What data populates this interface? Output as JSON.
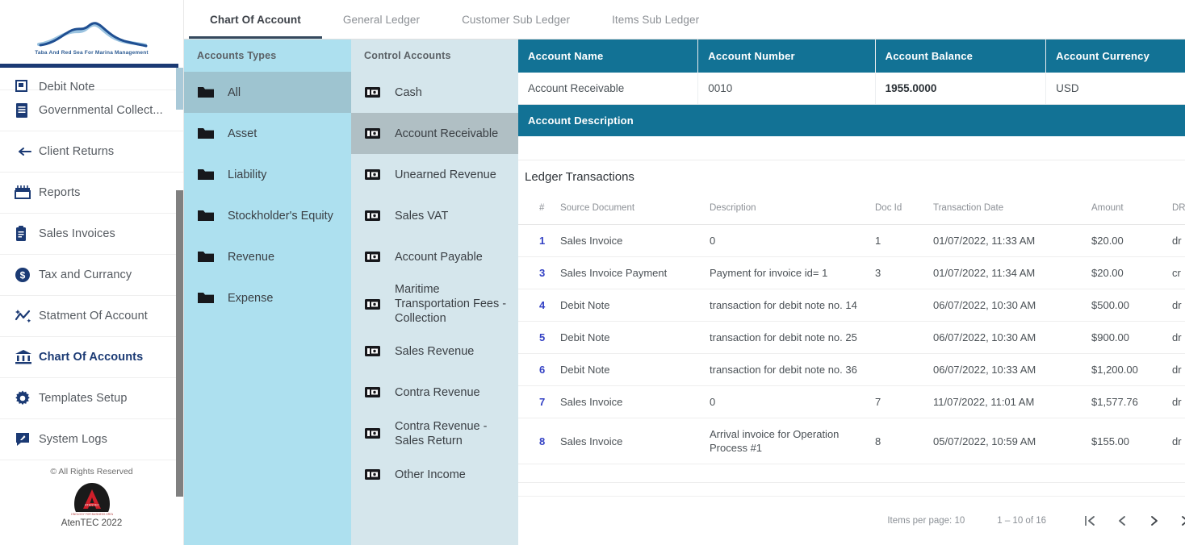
{
  "brand": {
    "subtitle": "Taba And  Red Sea For Marina Management",
    "logo_icon": "mountain-wave-logo"
  },
  "sidebar": {
    "items": [
      {
        "label": "Debit Note",
        "icon": "debit-note-icon",
        "active": false
      },
      {
        "label": "Governmental Collect...",
        "icon": "governmental-collection-icon",
        "active": false
      },
      {
        "label": "Client Returns",
        "icon": "return-arrow-icon",
        "active": false
      },
      {
        "label": "Reports",
        "icon": "reports-icon",
        "active": false
      },
      {
        "label": "Sales Invoices",
        "icon": "clipboard-icon",
        "active": false
      },
      {
        "label": "Tax and Currancy",
        "icon": "dollar-circle-icon",
        "active": false
      },
      {
        "label": "Statment Of Account",
        "icon": "trend-line-icon",
        "active": false
      },
      {
        "label": "Chart Of Accounts",
        "icon": "bank-icon",
        "active": true
      },
      {
        "label": "Templates Setup",
        "icon": "gear-icon",
        "active": false
      },
      {
        "label": "System Logs",
        "icon": "log-note-icon",
        "active": false
      }
    ],
    "footer": {
      "rights": "© All Rights Reserved",
      "vendor": "AtenTEC 2022",
      "vendor_logo_icon": "atentec-logo"
    }
  },
  "tabs": [
    {
      "label": "Chart Of Account",
      "active": true
    },
    {
      "label": "General Ledger",
      "active": false
    },
    {
      "label": "Customer Sub Ledger",
      "active": false
    },
    {
      "label": "Items Sub Ledger",
      "active": false
    }
  ],
  "accounts_types": {
    "header": "Accounts Types",
    "items": [
      {
        "label": "All",
        "icon": "folder-icon",
        "selected": true
      },
      {
        "label": "Asset",
        "icon": "folder-icon",
        "selected": false
      },
      {
        "label": "Liability",
        "icon": "folder-icon",
        "selected": false
      },
      {
        "label": "Stockholder's Equity",
        "icon": "folder-icon",
        "selected": false
      },
      {
        "label": "Revenue",
        "icon": "folder-icon",
        "selected": false
      },
      {
        "label": "Expense",
        "icon": "folder-icon",
        "selected": false
      }
    ]
  },
  "control_accounts": {
    "header": "Control Accounts",
    "items": [
      {
        "label": "Cash",
        "icon": "account-card-icon",
        "selected": false
      },
      {
        "label": "Account Receivable",
        "icon": "account-card-icon",
        "selected": true
      },
      {
        "label": "Unearned Revenue",
        "icon": "account-card-icon",
        "selected": false
      },
      {
        "label": "Sales VAT",
        "icon": "account-card-icon",
        "selected": false
      },
      {
        "label": "Account Payable",
        "icon": "account-card-icon",
        "selected": false
      },
      {
        "label": "Maritime Transportation Fees - Collection",
        "icon": "account-card-icon",
        "selected": false
      },
      {
        "label": "Sales Revenue",
        "icon": "account-card-icon",
        "selected": false
      },
      {
        "label": "Contra Revenue",
        "icon": "account-card-icon",
        "selected": false
      },
      {
        "label": "Contra Revenue - Sales Return",
        "icon": "account-card-icon",
        "selected": false
      },
      {
        "label": "Other Income",
        "icon": "account-card-icon",
        "selected": false
      }
    ]
  },
  "account_summary": {
    "columns": [
      "Account Name",
      "Account Number",
      "Account Balance",
      "Account Currency"
    ],
    "row": {
      "name": "Account Receivable",
      "number": "0010",
      "balance": "1955.0000",
      "currency": "USD"
    },
    "description_header": "Account Description",
    "description_value": ""
  },
  "ledger": {
    "title": "Ledger Transactions",
    "columns": [
      "#",
      "Source Document",
      "Description",
      "Doc Id",
      "Transaction Date",
      "Amount",
      "DR/CR"
    ],
    "rows": [
      {
        "idx": "1",
        "source": "Sales Invoice",
        "description": "0",
        "doc_id": "1",
        "date": "01/07/2022, 11:33 AM",
        "amount": "$20.00",
        "drcr": "dr"
      },
      {
        "idx": "3",
        "source": "Sales Invoice Payment",
        "description": "Payment for invoice id= 1",
        "doc_id": "3",
        "date": "01/07/2022, 11:34 AM",
        "amount": "$20.00",
        "drcr": "cr"
      },
      {
        "idx": "4",
        "source": "Debit Note",
        "description": "transaction for debit note no. 14",
        "doc_id": "",
        "date": "06/07/2022, 10:30 AM",
        "amount": "$500.00",
        "drcr": "dr"
      },
      {
        "idx": "5",
        "source": "Debit Note",
        "description": "transaction for debit note no. 25",
        "doc_id": "",
        "date": "06/07/2022, 10:30 AM",
        "amount": "$900.00",
        "drcr": "dr"
      },
      {
        "idx": "6",
        "source": "Debit Note",
        "description": "transaction for debit note no. 36",
        "doc_id": "",
        "date": "06/07/2022, 10:33 AM",
        "amount": "$1,200.00",
        "drcr": "dr"
      },
      {
        "idx": "7",
        "source": "Sales Invoice",
        "description": "0",
        "doc_id": "7",
        "date": "11/07/2022, 11:01 AM",
        "amount": "$1,577.76",
        "drcr": "dr"
      },
      {
        "idx": "8",
        "source": "Sales Invoice",
        "description": "Arrival invoice for Operation Process #1",
        "doc_id": "8",
        "date": "05/07/2022, 10:59 AM",
        "amount": "$155.00",
        "drcr": "dr"
      }
    ]
  },
  "paginator": {
    "items_per_page_label": "Items per page:",
    "items_per_page_value": "10",
    "range": "1 – 10 of 16",
    "first_icon": "first-page-icon",
    "prev_icon": "previous-page-icon",
    "next_icon": "next-page-icon",
    "last_icon": "last-page-icon"
  },
  "colors": {
    "teal_header": "#127295",
    "navy": "#1b3a74",
    "types_panel": "#ade0ef",
    "control_panel": "#d5e6ec",
    "index_blue": "#3341c4"
  }
}
